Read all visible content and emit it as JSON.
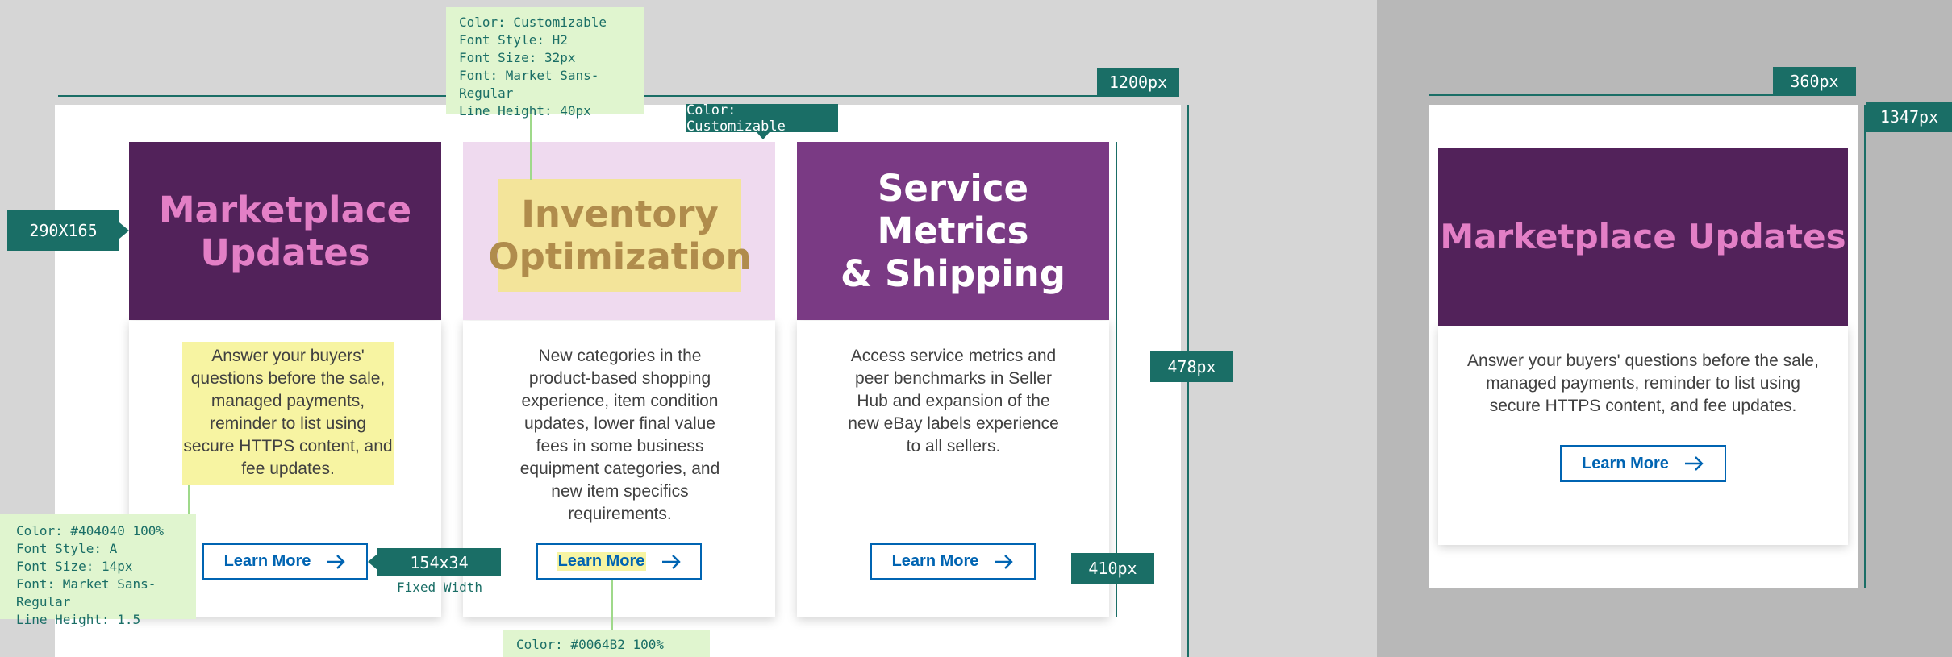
{
  "colors": {
    "teal": "#1a6e66",
    "note_bg": "#e0f5cf",
    "link": "#0064B2",
    "text": "#404040",
    "highlight": "#f7f4a2"
  },
  "cards": [
    {
      "title": "Marketplace Updates",
      "title_lines": [
        "Marketplace",
        "Updates"
      ],
      "tile_bg": "#52225a",
      "title_color": "#e37fc6",
      "desc": "Answer your buyers' questions before the sale, managed payments, reminder to list using secure HTTPS content, and fee updates.",
      "button": "Learn More"
    },
    {
      "title": "Inventory Optimization",
      "title_lines": [
        "Inventory",
        "Optimization"
      ],
      "tile_bg": "#efdaef",
      "title_color": "#b08c4c",
      "desc": "New categories in the product-based shopping experience, item condition updates, lower final value fees in some business equipment categories, and new item specifics requirements.",
      "button": "Learn More"
    },
    {
      "title": "Service Metrics & Shipping",
      "title_lines": [
        "Service Metrics",
        "& Shipping"
      ],
      "tile_bg": "#7a3a84",
      "title_color": "#ffffff",
      "desc": "Access service metrics and peer benchmarks in Seller Hub and expansion of the new eBay labels experience to all sellers.",
      "button": "Learn More"
    }
  ],
  "mobile": {
    "title": "Marketplace Updates",
    "desc": "Answer your buyers' questions before the sale, managed payments, reminder to list using secure HTTPS content, and fee updates.",
    "button": "Learn More"
  },
  "annotations": {
    "width_1200": "1200px",
    "height_478": "478px",
    "height_410": "410px",
    "width_360": "360px",
    "height_1347": "1347px",
    "tile_size": "290X165",
    "button_size": "154x34",
    "fixed_width": "Fixed Width",
    "color_custom": "Color:  Customizable",
    "h2_note": [
      "Color:  Customizable",
      "Font Style: H2",
      "Font Size: 32px",
      "Font: Market Sans-Regular",
      "Line Height: 40px"
    ],
    "body_note": [
      "Color:  #404040 100%",
      "Font Style: A",
      "Font Size: 14px",
      "Font: Market Sans-Regular",
      "Line Height: 1.5"
    ],
    "link_note": "Color:  #0064B2 100%"
  }
}
